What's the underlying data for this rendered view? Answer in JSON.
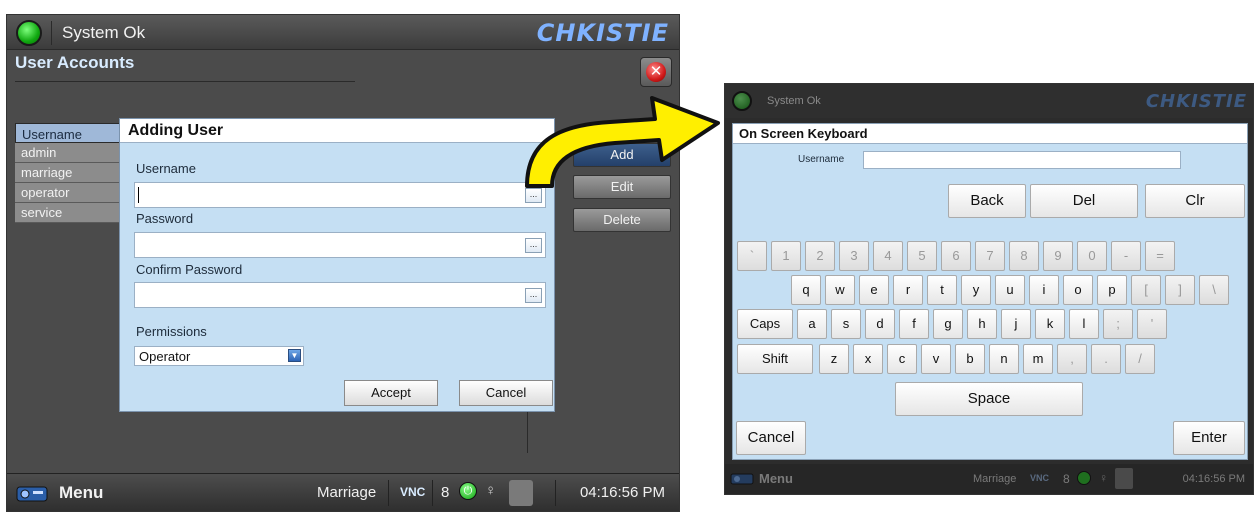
{
  "left_screen": {
    "status_text": "System Ok",
    "logo": "CHKISTIE",
    "page_title": "User Accounts",
    "users_header": "Username",
    "users": [
      "admin",
      "marriage",
      "operator",
      "service"
    ],
    "side_buttons": [
      "Add",
      "Edit",
      "Delete"
    ],
    "dialog": {
      "title": "Adding User",
      "username_label": "Username",
      "password_label": "Password",
      "confirm_label": "Confirm Password",
      "permissions_label": "Permissions",
      "permissions_value": "Operator",
      "accept": "Accept",
      "cancel": "Cancel",
      "ellipsis": "..."
    },
    "bottom": {
      "menu": "Menu",
      "user": "Marriage",
      "vnc": "VNC",
      "count": "8",
      "time": "04:16:56 PM"
    }
  },
  "right_screen": {
    "status_text": "System Ok",
    "logo": "CHKISTIE",
    "keyboard_title": "On Screen Keyboard",
    "username_label": "Username",
    "keys": {
      "back": "Back",
      "del": "Del",
      "clr": "Clr",
      "row1": [
        "`",
        "1",
        "2",
        "3",
        "4",
        "5",
        "6",
        "7",
        "8",
        "9",
        "0",
        "-",
        "="
      ],
      "row2": [
        "q",
        "w",
        "e",
        "r",
        "t",
        "y",
        "u",
        "i",
        "o",
        "p",
        "[",
        "]",
        "\\"
      ],
      "caps": "Caps",
      "row3": [
        "a",
        "s",
        "d",
        "f",
        "g",
        "h",
        "j",
        "k",
        "l",
        ";",
        "'"
      ],
      "shift": "Shift",
      "row4": [
        "z",
        "x",
        "c",
        "v",
        "b",
        "n",
        "m",
        ",",
        ".",
        "/"
      ],
      "space": "Space",
      "cancel": "Cancel",
      "enter": "Enter"
    },
    "bottom": {
      "menu": "Menu",
      "user": "Marriage",
      "vnc": "VNC",
      "count": "8",
      "time": "04:16:56 PM"
    }
  },
  "colors": {
    "arrow_fill": "#ffef00",
    "dialog_bg": "#c5dff3",
    "logo_blue": "#7fb2ff"
  }
}
